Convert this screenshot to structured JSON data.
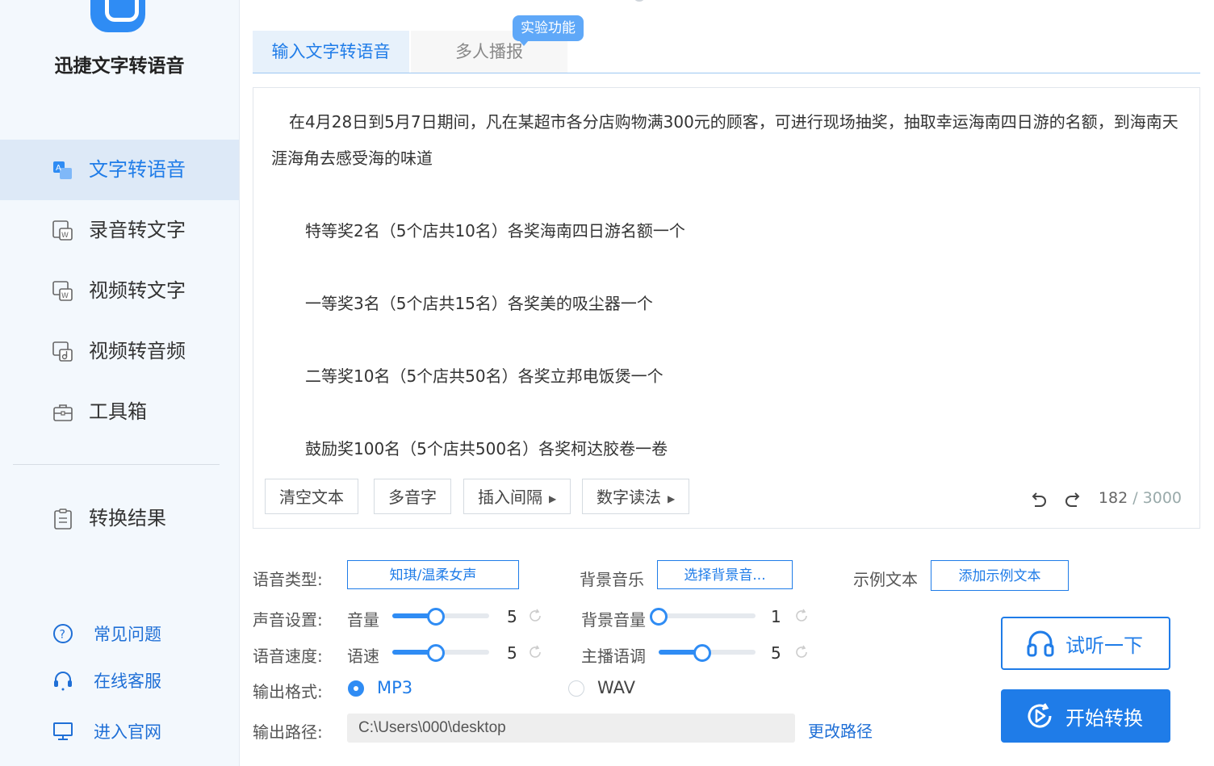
{
  "app": {
    "title": "迅捷文字转语音"
  },
  "sidebar": {
    "items": [
      {
        "label": "文字转语音",
        "icon": "text-to-speech-icon",
        "active": true
      },
      {
        "label": "录音转文字",
        "icon": "audio-to-text-icon",
        "active": false
      },
      {
        "label": "视频转文字",
        "icon": "video-to-text-icon",
        "active": false
      },
      {
        "label": "视频转音频",
        "icon": "video-to-audio-icon",
        "active": false
      },
      {
        "label": "工具箱",
        "icon": "toolbox-icon",
        "active": false
      },
      {
        "label": "转换结果",
        "icon": "clipboard-icon",
        "active": false
      }
    ],
    "bottom_links": [
      {
        "label": "常见问题",
        "icon": "help-icon"
      },
      {
        "label": "在线客服",
        "icon": "headset-icon"
      },
      {
        "label": "进入官网",
        "icon": "monitor-icon"
      }
    ]
  },
  "tabs": [
    {
      "label": "输入文字转语音",
      "active": true
    },
    {
      "label": "多人播报",
      "active": false
    }
  ],
  "badge": "实验功能",
  "editor": {
    "paragraph": "在4月28日到5月7日期间，凡在某超市各分店购物满300元的顾客，可进行现场抽奖，抽取幸运海南四日游的名额，到海南天涯海角去感受海的味道",
    "prizes": [
      "特等奖2名（5个店共10名）各奖海南四日游名额一个",
      "一等奖3名（5个店共15名）各奖美的吸尘器一个",
      "二等奖10名（5个店共50名）各奖立邦电饭煲一个",
      "鼓励奖100名（5个店共500名）各奖柯达胶卷一卷"
    ],
    "buttons": {
      "clear": "清空文本",
      "polyphone": "多音字",
      "insert_pause": "插入间隔",
      "number_reading": "数字读法"
    },
    "count": "182",
    "max": "/ 3000"
  },
  "settings": {
    "voice_type_label": "语音类型:",
    "voice_type_value": "知琪/温柔女声",
    "bgm_label": "背景音乐",
    "bgm_value": "选择背景音...",
    "sample_label": "示例文本",
    "sample_value": "添加示例文本",
    "sound_label": "声音设置:",
    "volume_label": "音量",
    "volume_value": "5",
    "volume_level": 0.45,
    "bg_volume_label": "背景音量",
    "bg_volume_value": "1",
    "bg_volume_level": 0.0,
    "speed_section_label": "语音速度:",
    "speed_label": "语速",
    "speed_value": "5",
    "speed_level": 0.45,
    "pitch_label": "主播语调",
    "pitch_value": "5",
    "pitch_level": 0.45,
    "format_label": "输出格式:",
    "format_mp3": "MP3",
    "format_wav": "WAV",
    "format_selected": "MP3",
    "path_label": "输出路径:",
    "path_value": "C:\\Users\\000\\desktop",
    "change_path": "更改路径"
  },
  "actions": {
    "preview": "试听一下",
    "start": "开始转换"
  },
  "colors": {
    "accent": "#1f7ce8",
    "sidebar_bg": "#f3f8fd",
    "badge": "#5fa8f8"
  }
}
